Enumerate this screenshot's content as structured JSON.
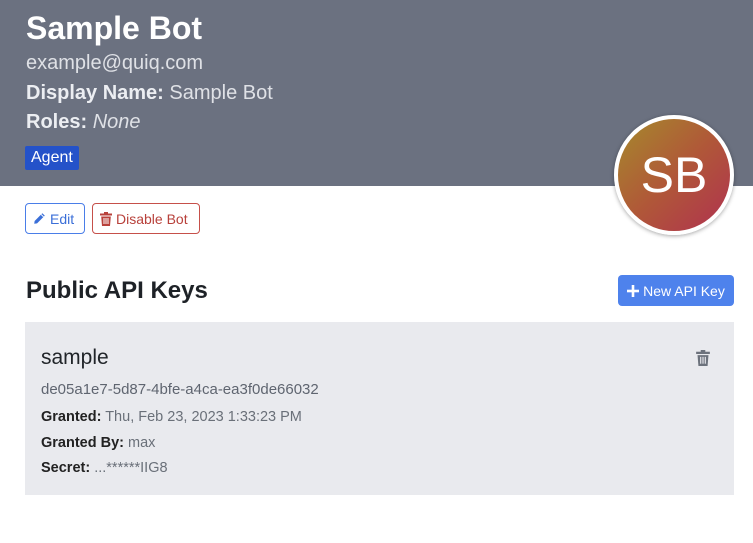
{
  "profile": {
    "name": "Sample Bot",
    "email": "example@quiq.com",
    "display_name_label": "Display Name:",
    "display_name_value": "Sample Bot",
    "roles_label": "Roles:",
    "roles_value": "None",
    "badge": "Agent",
    "avatar_initials": "SB"
  },
  "actions": {
    "edit_label": "Edit",
    "disable_label": "Disable Bot"
  },
  "api_keys": {
    "title": "Public API Keys",
    "new_label": "New API Key",
    "items": [
      {
        "name": "sample",
        "id": "de05a1e7-5d87-4bfe-a4ca-ea3f0de66032",
        "granted_label": "Granted:",
        "granted_value": "Thu, Feb 23, 2023 1:33:23 PM",
        "granted_by_label": "Granted By:",
        "granted_by_value": "max",
        "secret_label": "Secret:",
        "secret_value": "...******IIG8"
      }
    ]
  },
  "colors": {
    "header_bg": "#6b7180",
    "badge_bg": "#2452c9",
    "primary": "#4e82ec",
    "danger": "#b8413b",
    "card_bg": "#e9eaee"
  },
  "icons": [
    "pencil-icon",
    "trash-icon",
    "plus-icon"
  ]
}
